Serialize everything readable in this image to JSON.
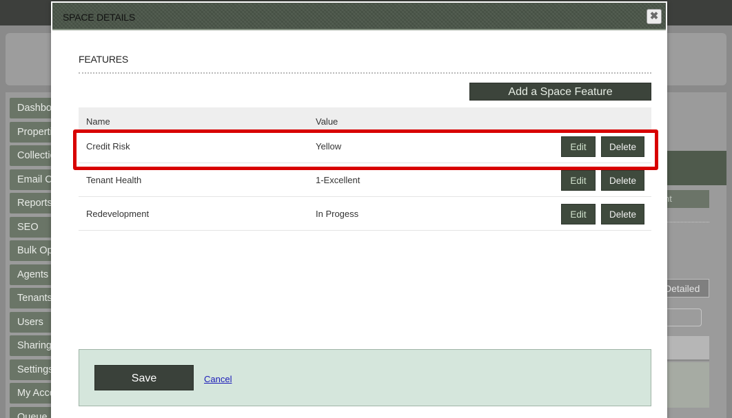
{
  "background": {
    "nav_items": [
      "Dashboard",
      "Properties",
      "Collections",
      "Email Campaigns",
      "Reports",
      "SEO",
      "Bulk Operations",
      "Agents",
      "Tenants",
      "Users",
      "Sharing",
      "Settings",
      "My Account",
      "Queue"
    ],
    "panel_button_1": "nt",
    "panel_button_2": "Detailed"
  },
  "modal": {
    "title": "SPACE DETAILS",
    "close_icon": "close-icon",
    "section_title": "FEATURES",
    "add_button_label": "Add a Space Feature",
    "table": {
      "headers": {
        "name": "Name",
        "value": "Value"
      },
      "rows": [
        {
          "name": "Credit Risk",
          "value": "Yellow",
          "edit": "Edit",
          "delete": "Delete"
        },
        {
          "name": "Tenant Health",
          "value": "1-Excellent",
          "edit": "Edit",
          "delete": "Delete"
        },
        {
          "name": "Redevelopment",
          "value": "In Progess",
          "edit": "Edit",
          "delete": "Delete"
        }
      ]
    },
    "footer": {
      "save_label": "Save",
      "cancel_label": "Cancel"
    }
  },
  "colors": {
    "titlebar": "#4b5649",
    "button_dark": "#3f4a3d",
    "footer_bg": "#d5e6dc",
    "highlight": "#d80000",
    "link": "#1a1ab8"
  }
}
